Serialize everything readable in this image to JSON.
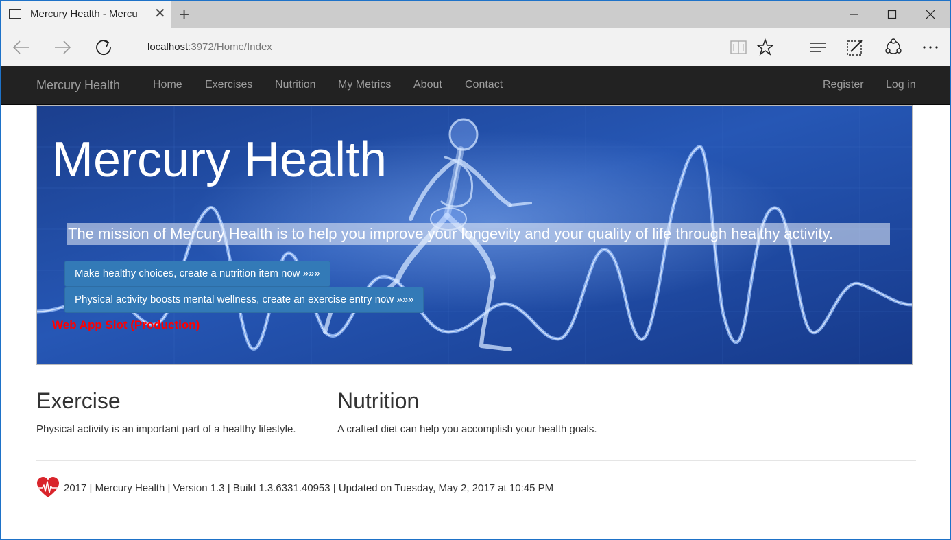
{
  "browser": {
    "tab_title": "Mercury Health - Mercu",
    "url_host": "localhost",
    "url_path": ":3972/Home/Index"
  },
  "navbar": {
    "brand": "Mercury Health",
    "links": [
      "Home",
      "Exercises",
      "Nutrition",
      "My Metrics",
      "About",
      "Contact"
    ],
    "right_links": [
      "Register",
      "Log in"
    ]
  },
  "hero": {
    "title": "Mercury Health",
    "mission": "The mission of Mercury Health is to help you improve your longevity and your quality of life through healthy activity.",
    "nutrition_button": "Make healthy choices, create a nutrition item now »»»",
    "exercise_button": "Physical activity boosts mental wellness, create an exercise entry now »»»",
    "slot_label": "Web App Slot (Production)"
  },
  "sections": {
    "exercise": {
      "heading": "Exercise",
      "text": "Physical activity is an important part of a healthy lifestyle."
    },
    "nutrition": {
      "heading": "Nutrition",
      "text": "A crafted diet can help you accomplish your health goals."
    }
  },
  "footer": {
    "text": "2017 | Mercury Health | Version 1.3 | Build 1.3.6331.40953 | Updated on Tuesday, May 2, 2017 at 10:45 PM"
  },
  "colors": {
    "navbar_bg": "#222222",
    "hero_blue": "#1f4fa8",
    "button_blue": "#337ab7",
    "slot_red": "#ff0000",
    "heart_red": "#d9242b"
  }
}
